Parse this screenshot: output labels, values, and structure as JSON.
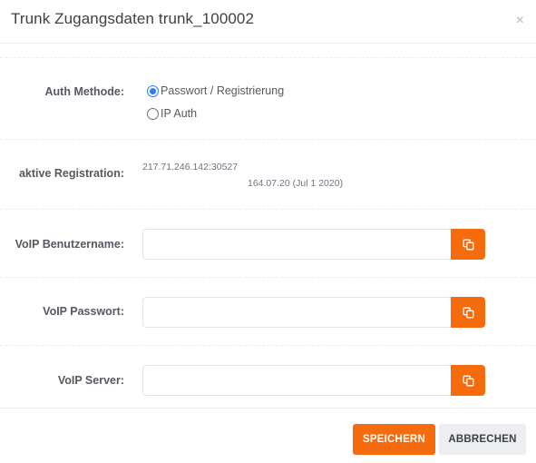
{
  "header": {
    "title": "Trunk Zugangsdaten trunk_100002",
    "close_symbol": "×"
  },
  "auth": {
    "label": "Auth Methode:",
    "options": [
      {
        "label": "Passwort / Registrierung",
        "selected": true
      },
      {
        "label": "IP Auth",
        "selected": false
      }
    ]
  },
  "registration": {
    "label": "aktive Registration:",
    "address": "217.71.246.142:30527",
    "info": "164.07.20 (Jul 1 2020)"
  },
  "fields": {
    "username": {
      "label": "VoIP Benutzername:",
      "value": ""
    },
    "password": {
      "label": "VoIP Passwort:",
      "value": ""
    },
    "server": {
      "label": "VoIP Server:",
      "value": ""
    }
  },
  "footer": {
    "save_label": "SPEICHERN",
    "cancel_label": "ABBRECHEN"
  },
  "colors": {
    "accent": "#f66b0e",
    "radio_selected": "#2f7cf6"
  },
  "icons": {
    "copy": "copy-icon",
    "close": "close-icon"
  }
}
